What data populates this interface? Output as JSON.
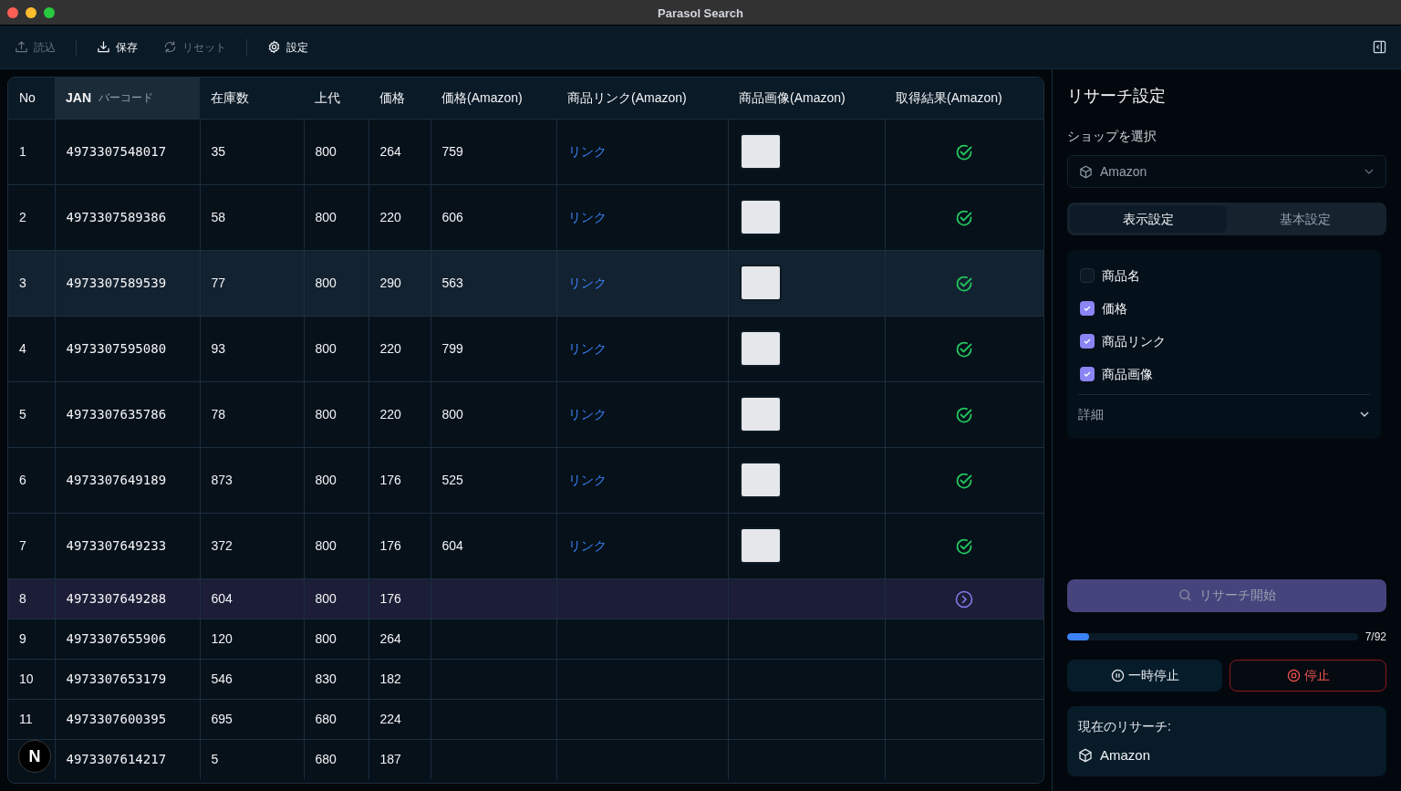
{
  "window": {
    "title": "Parasol Search"
  },
  "toolbar": [
    {
      "kind": "upload",
      "label": "読込",
      "disabled": true
    },
    {
      "kind": "download",
      "label": "保存",
      "disabled": false
    },
    {
      "kind": "reset",
      "label": "リセット",
      "disabled": true
    },
    {
      "kind": "gear",
      "label": "設定",
      "disabled": false
    }
  ],
  "table": {
    "columns": [
      {
        "label": "No",
        "active": false
      },
      {
        "label": "JAN",
        "sublabel": "バーコード",
        "active": true
      },
      {
        "label": "在庫数",
        "active": false
      },
      {
        "label": "上代",
        "active": false
      },
      {
        "label": "価格",
        "active": false
      },
      {
        "label": "価格(Amazon)",
        "active": false
      },
      {
        "label": "商品リンク(Amazon)",
        "active": false
      },
      {
        "label": "商品画像(Amazon)",
        "active": false
      },
      {
        "label": "取得結果(Amazon)",
        "active": false
      }
    ],
    "rows": [
      {
        "no": "1",
        "jan": "4973307548017",
        "stock": "35",
        "list_price": "800",
        "price": "264",
        "amazon_price": "759",
        "link": "リンク",
        "image": true,
        "kind": "done",
        "selected": false,
        "hovered": false
      },
      {
        "no": "2",
        "jan": "4973307589386",
        "stock": "58",
        "list_price": "800",
        "price": "220",
        "amazon_price": "606",
        "link": "リンク",
        "image": true,
        "kind": "done",
        "selected": false,
        "hovered": false
      },
      {
        "no": "3",
        "jan": "4973307589539",
        "stock": "77",
        "list_price": "800",
        "price": "290",
        "amazon_price": "563",
        "link": "リンク",
        "image": true,
        "kind": "done",
        "selected": false,
        "hovered": true
      },
      {
        "no": "4",
        "jan": "4973307595080",
        "stock": "93",
        "list_price": "800",
        "price": "220",
        "amazon_price": "799",
        "link": "リンク",
        "image": true,
        "kind": "done",
        "selected": false,
        "hovered": false
      },
      {
        "no": "5",
        "jan": "4973307635786",
        "stock": "78",
        "list_price": "800",
        "price": "220",
        "amazon_price": "800",
        "link": "リンク",
        "image": true,
        "kind": "done",
        "selected": false,
        "hovered": false
      },
      {
        "no": "6",
        "jan": "4973307649189",
        "stock": "873",
        "list_price": "800",
        "price": "176",
        "amazon_price": "525",
        "link": "リンク",
        "image": true,
        "kind": "done",
        "selected": false,
        "hovered": false
      },
      {
        "no": "7",
        "jan": "4973307649233",
        "stock": "372",
        "list_price": "800",
        "price": "176",
        "amazon_price": "604",
        "link": "リンク",
        "image": true,
        "kind": "done",
        "selected": false,
        "hovered": false
      },
      {
        "no": "8",
        "jan": "4973307649288",
        "stock": "604",
        "list_price": "800",
        "price": "176",
        "kind": "loading",
        "selected": true,
        "hovered": false
      },
      {
        "no": "9",
        "jan": "4973307655906",
        "stock": "120",
        "list_price": "800",
        "price": "264",
        "kind": "pending",
        "selected": false,
        "hovered": false
      },
      {
        "no": "10",
        "jan": "4973307653179",
        "stock": "546",
        "list_price": "830",
        "price": "182",
        "kind": "pending",
        "selected": false,
        "hovered": false
      },
      {
        "no": "11",
        "jan": "4973307600395",
        "stock": "695",
        "list_price": "680",
        "price": "224",
        "kind": "pending",
        "selected": false,
        "hovered": false
      },
      {
        "jan": "4973307614217",
        "stock": "5",
        "list_price": "680",
        "price": "187",
        "kind": "pending",
        "selected": false,
        "hovered": false
      }
    ]
  },
  "badge": {
    "label": "N"
  },
  "sidebar": {
    "title": "リサーチ設定",
    "shop_label": "ショップを選択",
    "shop_select": {
      "value": "Amazon"
    },
    "tabs": [
      {
        "label": "表示設定",
        "selected": true
      },
      {
        "label": "基本設定",
        "selected": false
      }
    ],
    "options": [
      {
        "label": "商品名",
        "checked": false
      },
      {
        "label": "価格",
        "checked": true
      },
      {
        "label": "商品リンク",
        "checked": true
      },
      {
        "label": "商品画像",
        "checked": true
      }
    ],
    "details": {
      "label": "詳細",
      "expanded": false
    },
    "start_button": {
      "label": "リサーチ開始",
      "disabled": true
    },
    "progress": {
      "level": 0.076,
      "reading": "7/92"
    },
    "pause_button": {
      "label": "一時停止"
    },
    "stop_button": {
      "label": "停止"
    },
    "current": {
      "label": "現在のリサーチ:",
      "shop": "Amazon"
    }
  }
}
